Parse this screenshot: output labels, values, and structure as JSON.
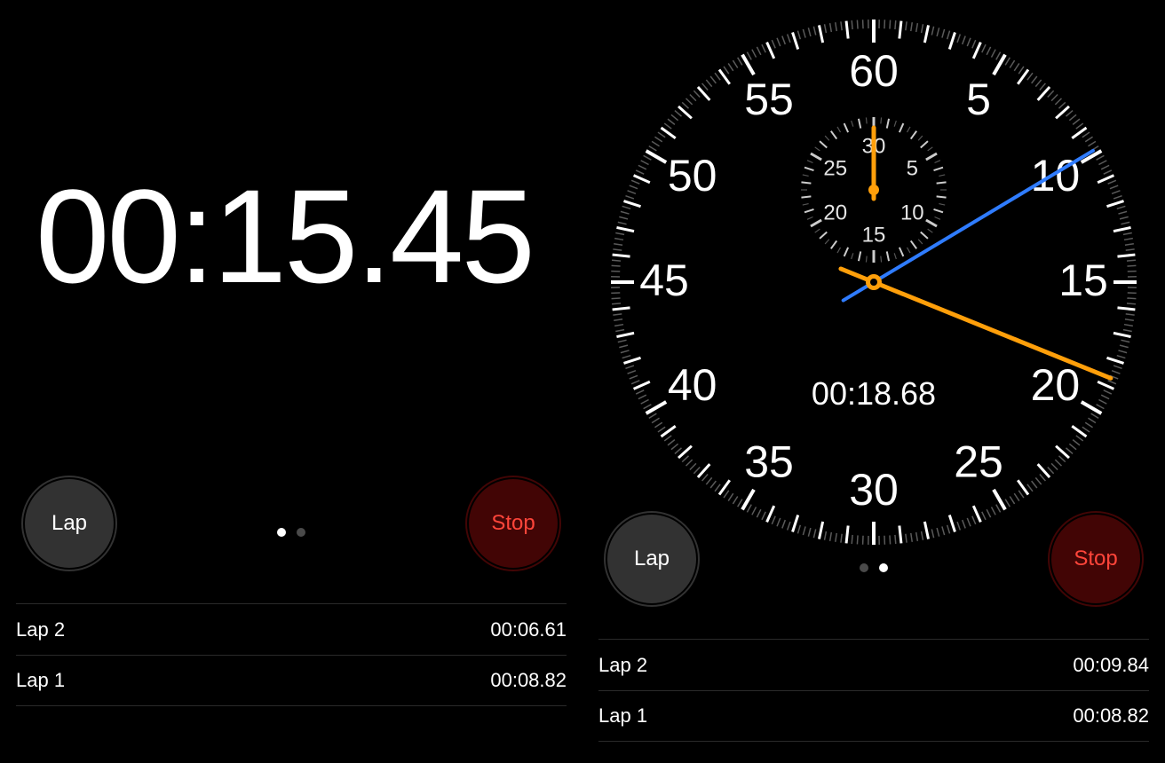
{
  "left": {
    "time_display": "00:15.45",
    "lap_label": "Lap",
    "stop_label": "Stop",
    "active_page": 0,
    "laps": [
      {
        "label": "Lap 2",
        "time": "00:06.61"
      },
      {
        "label": "Lap 1",
        "time": "00:08.82"
      }
    ]
  },
  "right": {
    "time_display": "00:18.68",
    "lap_label": "Lap",
    "stop_label": "Stop",
    "active_page": 1,
    "laps": [
      {
        "label": "Lap 2",
        "time": "00:09.84"
      },
      {
        "label": "Lap 1",
        "time": "00:08.82"
      }
    ],
    "dial": {
      "major_numerals": [
        "60",
        "5",
        "10",
        "15",
        "20",
        "25",
        "30",
        "35",
        "40",
        "45",
        "50",
        "55"
      ],
      "sub_numerals": [
        "30",
        "5",
        "10",
        "15",
        "20",
        "25"
      ],
      "main_hand_seconds": 18.68,
      "lap_hand_seconds": 9.84,
      "sub_hand_minutes": 0
    }
  },
  "colors": {
    "hand_main": "#ff9f0a",
    "hand_lap": "#2f7cff",
    "stop_text": "#ff453a"
  }
}
